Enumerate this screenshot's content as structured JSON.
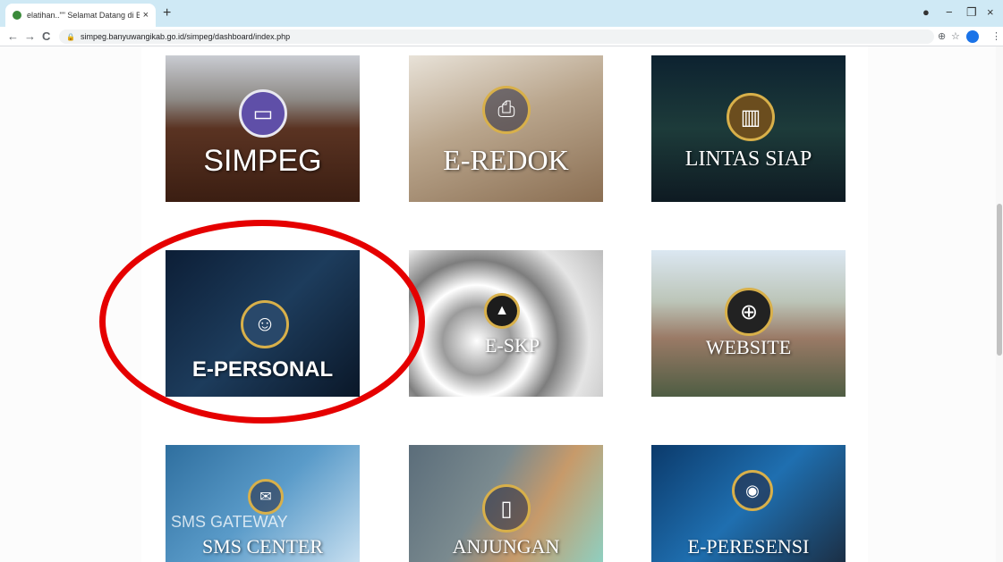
{
  "browser": {
    "tab_title": "elatihan..\"\" Selamat Datang di Bu",
    "tab_close": "×",
    "new_tab": "+",
    "url": "simpeg.banyuwangikab.go.id/simpeg/dashboard/index.php",
    "controls": {
      "minimize": "−",
      "restore": "❐",
      "close": "×"
    },
    "nav": {
      "back": "←",
      "forward": "→",
      "reload": "C"
    },
    "icons": {
      "zoom": "⊕",
      "star": "☆",
      "menu": "⋮",
      "record": "●"
    }
  },
  "tiles": [
    {
      "label": "SIMPEG",
      "icon": "book-icon",
      "glyph": "▭"
    },
    {
      "label": "E-REDOK",
      "icon": "printer-icon",
      "glyph": "⎙"
    },
    {
      "label": "LINTAS SIAP",
      "icon": "cabinet-icon",
      "glyph": "▥"
    },
    {
      "label": "E-PERSONAL",
      "icon": "person-icon",
      "glyph": "☺"
    },
    {
      "label": "E-SKP",
      "icon": "chart-icon",
      "glyph": "▲"
    },
    {
      "label": "WEBSITE",
      "icon": "globe-icon",
      "glyph": "⊕"
    },
    {
      "label": "SMS CENTER",
      "sublabel": "SMS GATEWAY",
      "icon": "sms-icon",
      "glyph": "✉"
    },
    {
      "label": "ANJUNGAN",
      "icon": "kiosk-icon",
      "glyph": "▯"
    },
    {
      "label": "E-PERESENSI",
      "icon": "fingerprint-icon",
      "glyph": "◉"
    }
  ],
  "highlight_color": "#e50000"
}
